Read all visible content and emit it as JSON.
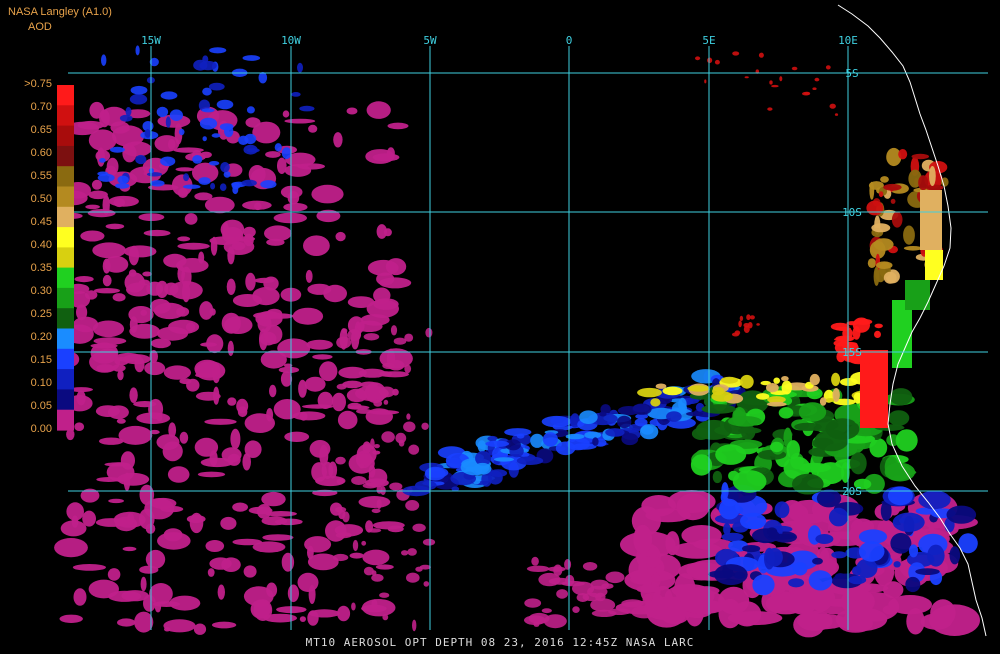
{
  "header": {
    "source": "NASA Langley (A1.0)",
    "variable": "AOD"
  },
  "colorbar": {
    "labels": [
      ">0.75",
      "0.70",
      "0.65",
      "0.60",
      "0.55",
      "0.50",
      "0.45",
      "0.40",
      "0.35",
      "0.30",
      "0.25",
      "0.20",
      "0.15",
      "0.10",
      "0.05",
      "0.00"
    ],
    "colors": [
      "#ff1a1a",
      "#d01010",
      "#a80c0c",
      "#7c1010",
      "#8a6a10",
      "#b48a20",
      "#e0b060",
      "#ffff20",
      "#d8d010",
      "#20d020",
      "#18a018",
      "#106010",
      "#1a8cff",
      "#1a40ff",
      "#1020c0",
      "#0a0a80",
      "#c0208a"
    ]
  },
  "grid": {
    "longitudes": [
      "15W",
      "10W",
      "5W",
      "0",
      "5E",
      "10E"
    ],
    "latitudes": [
      "5S",
      "10S",
      "15S",
      "20S"
    ]
  },
  "footer": {
    "caption": "MT10  AEROSOL OPT DEPTH   08 23, 2016 12:45Z   NASA LARC"
  }
}
